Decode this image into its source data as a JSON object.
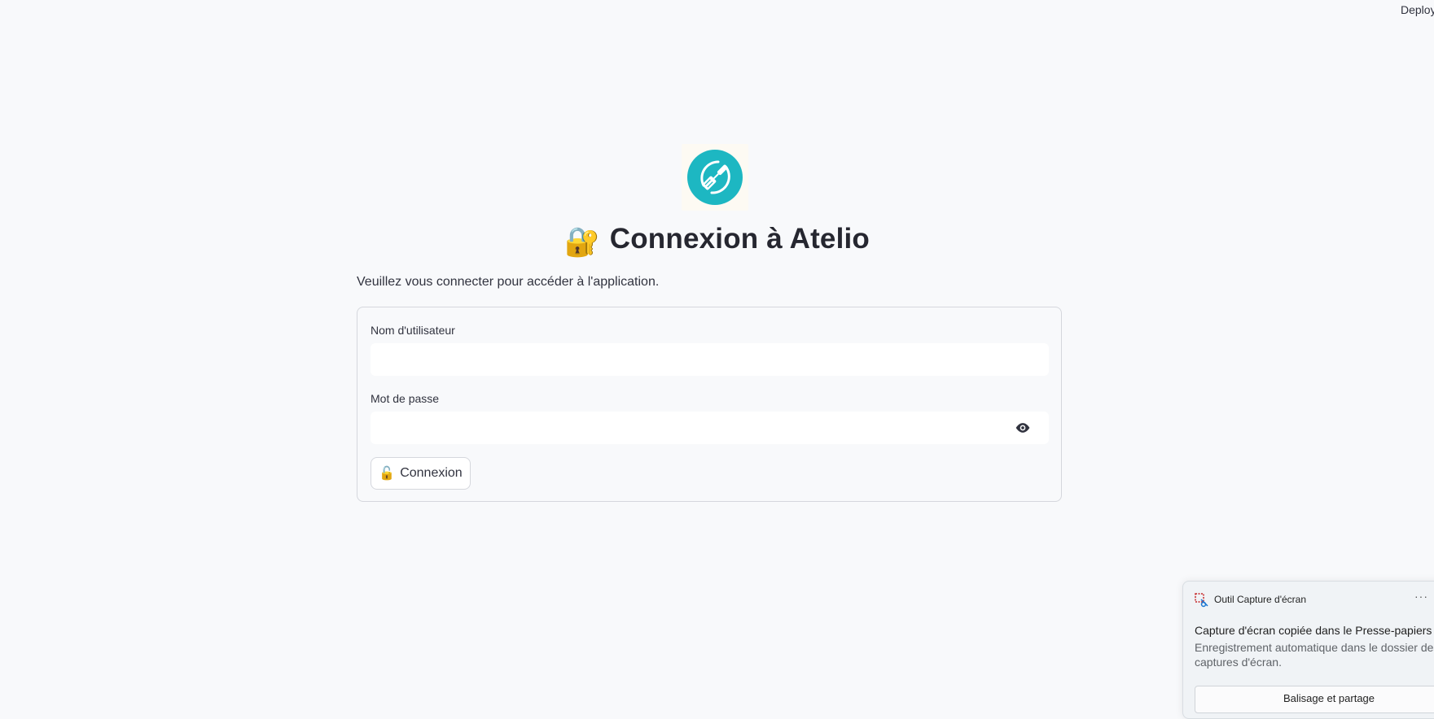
{
  "header": {
    "deploy_label": "Deploy"
  },
  "login": {
    "logo_icon": "screwdriver-wrench-icon",
    "title_emoji": "🔐",
    "title": "Connexion à Atelio",
    "subtitle": "Veuillez vous connecter pour accéder à l'application.",
    "username_label": "Nom d'utilisateur",
    "username_value": "",
    "password_label": "Mot de passe",
    "password_value": "",
    "submit_emoji": "🔓",
    "submit_label": "Connexion",
    "accent_color": "#1db7c2"
  },
  "notification": {
    "app_name": "Outil Capture d'écran",
    "more_label": "···",
    "title": "Capture d'écran copiée dans le Presse-papiers",
    "body": "Enregistrement automatique dans le dossier des captures d'écran.",
    "action_label": "Balisage et partage"
  }
}
